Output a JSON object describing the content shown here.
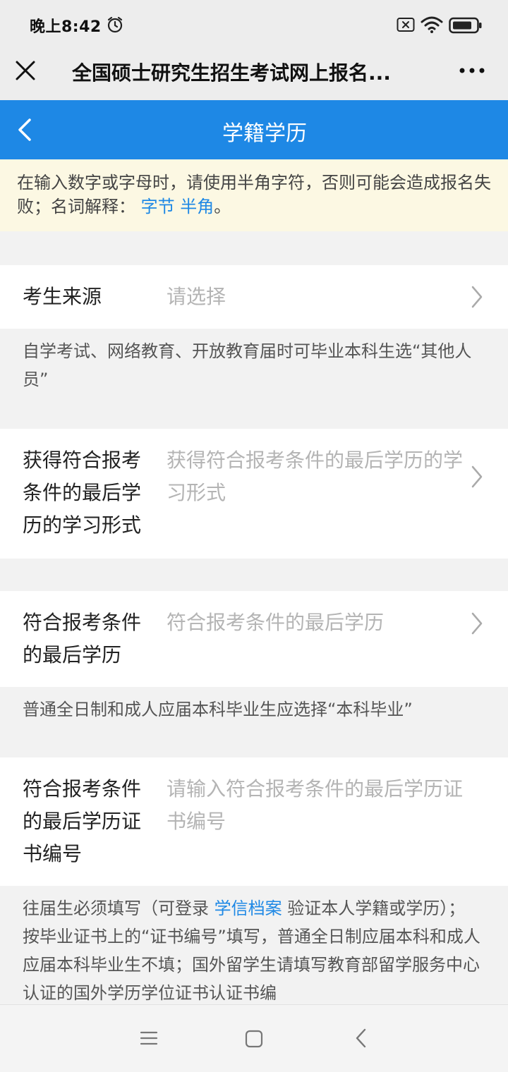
{
  "status_bar": {
    "time": "晚上8:42"
  },
  "title_bar": {
    "title": "全国硕士研究生招生考试网上报名..."
  },
  "nav": {
    "title": "学籍学历"
  },
  "notice": {
    "text": "在输入数字或字母时，请使用半角字符，否则可能会造成报名失败；名词解释：",
    "link_byte": "字节",
    "link_halfwidth": "半角",
    "suffix": "。"
  },
  "fields": [
    {
      "label": "考生来源",
      "value": "请选择",
      "hint": "自学考试、网络教育、开放教育届时可毕业本科生选“其他人员”"
    },
    {
      "label": "获得符合报考条件的最后学历的学习形式",
      "value": "获得符合报考条件的最后学历的学习形式"
    },
    {
      "label": "符合报考条件的最后学历",
      "value": "符合报考条件的最后学历",
      "hint": "普通全日制和成人应届本科毕业生应选择“本科毕业”"
    },
    {
      "label": "符合报考条件的最后学历证书编号",
      "placeholder": "请输入符合报考条件的最后学历证书编号",
      "hint_before_link": "往届生必须填写（可登录",
      "hint_link": "学信档案",
      "hint_after_link": "验证本人学籍或学历）； 按毕业证书上的“证书编号”填写，普通全日制应届本科和成人应届本科毕业生不填；国外留学生请填写教育部留学服务中心认证的国外学历学位证书认证书编"
    }
  ],
  "colors": {
    "primary": "#1e88e5",
    "notice_bg": "#fcf8e3",
    "placeholder": "#b4b4b4"
  },
  "icons": [
    "alarm-icon",
    "sim-icon",
    "wifi-icon",
    "battery-icon",
    "close-icon",
    "more-icon",
    "back-arrow-icon",
    "chevron-right-icon",
    "menu-icon",
    "home-icon",
    "nav-back-icon"
  ]
}
